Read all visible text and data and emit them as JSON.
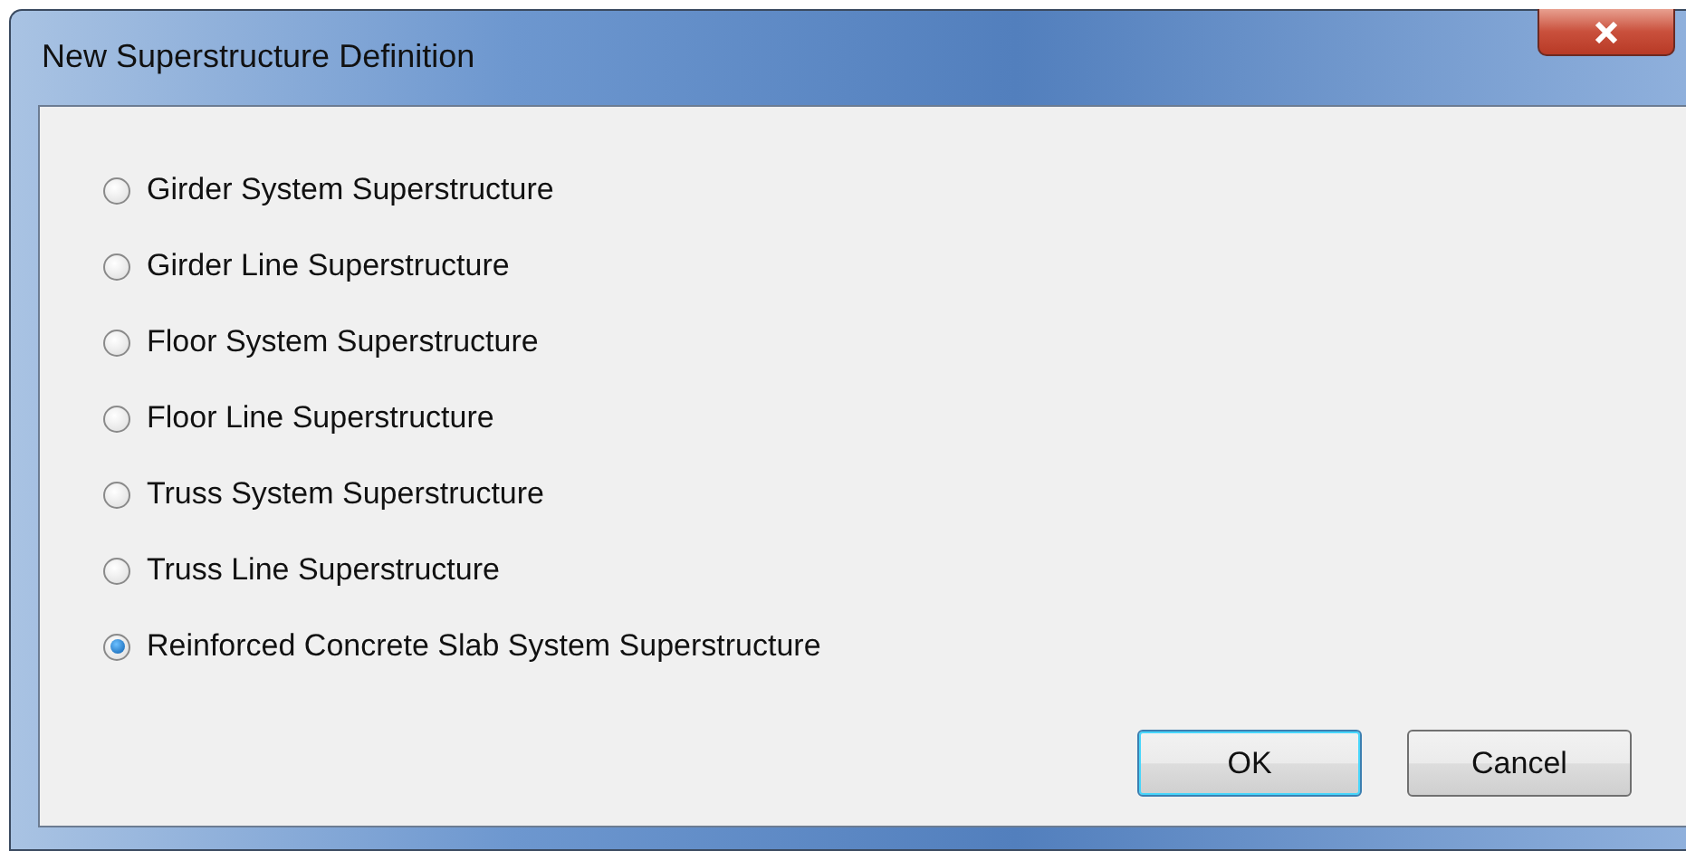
{
  "window": {
    "title": "New Superstructure Definition"
  },
  "options": [
    {
      "label": "Girder System Superstructure",
      "selected": false
    },
    {
      "label": "Girder Line Superstructure",
      "selected": false
    },
    {
      "label": "Floor System Superstructure",
      "selected": false
    },
    {
      "label": "Floor Line Superstructure",
      "selected": false
    },
    {
      "label": "Truss System Superstructure",
      "selected": false
    },
    {
      "label": "Truss Line Superstructure",
      "selected": false
    },
    {
      "label": "Reinforced Concrete Slab System Superstructure",
      "selected": true
    }
  ],
  "buttons": [
    {
      "label": "OK",
      "default": true
    },
    {
      "label": "Cancel",
      "default": false
    }
  ]
}
